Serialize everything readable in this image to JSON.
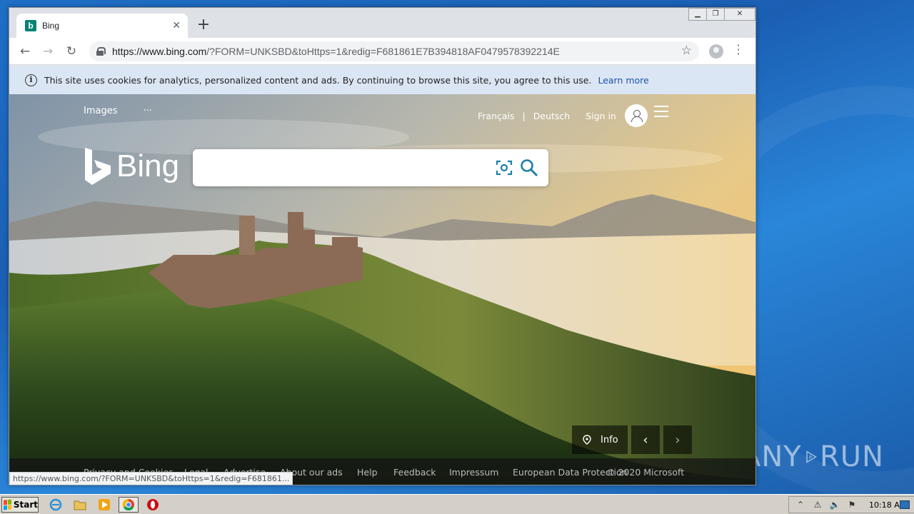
{
  "browser": {
    "tab_title": "Bing",
    "tab_favicon": "b",
    "url_host": "https://www.bing.com",
    "url_path": "/?FORM=UNKSBD&toHttps=1&redig=F681861E7B394818AF0479578392214E"
  },
  "cookie_banner": {
    "text": "This site uses cookies for analytics, personalized content and ads. By continuing to browse this site, you agree to this use.",
    "link": "Learn more"
  },
  "bing": {
    "nav_left": [
      "Images",
      "···"
    ],
    "lang_1": "Français",
    "sep": "|",
    "lang_2": "Deutsch",
    "sign_in": "Sign in",
    "logo_text": "Bing",
    "search_value": "",
    "info_label": "Info",
    "prev_glyph": "‹",
    "next_glyph": "›"
  },
  "footer": {
    "items": [
      "Privacy and Cookies",
      "Legal",
      "Advertise",
      "About our ads",
      "Help",
      "Feedback",
      "Impressum",
      "European Data Protection"
    ],
    "copyright": "© 2020 Microsoft"
  },
  "status_url": "https://www.bing.com/?FORM=UNKSBD&toHttps=1&redig=F681861...",
  "taskbar": {
    "start_label": "Start",
    "clock": "10:18 AM"
  },
  "watermark": {
    "left": "ANY",
    "right": "RUN"
  },
  "colors": {
    "bing_teal": "#008373",
    "cookie_bg": "#dbe6f5",
    "search_icon": "#1d7fa8"
  }
}
